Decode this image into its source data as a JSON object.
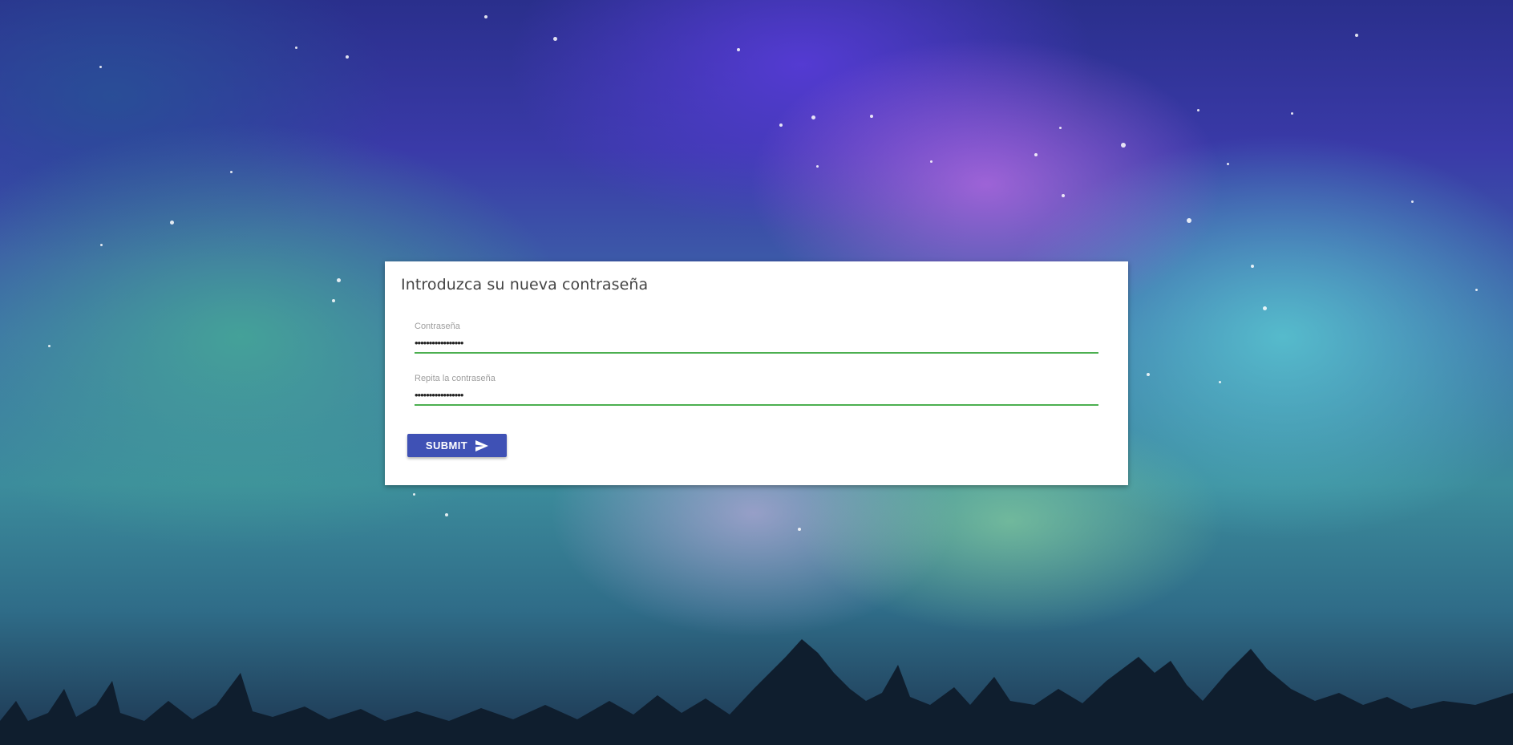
{
  "form": {
    "title": "Introduzca su nueva contraseña",
    "password": {
      "label": "Contraseña",
      "value": "•••••••••••••••••"
    },
    "repeat_password": {
      "label": "Repita la contraseña",
      "value": "•••••••••••••••••"
    },
    "submit_label": "SUBMIT",
    "submit_icon": "send-icon"
  },
  "colors": {
    "button": "#3f51b5",
    "field_underline": "#4caf50",
    "card": "#ffffff"
  }
}
